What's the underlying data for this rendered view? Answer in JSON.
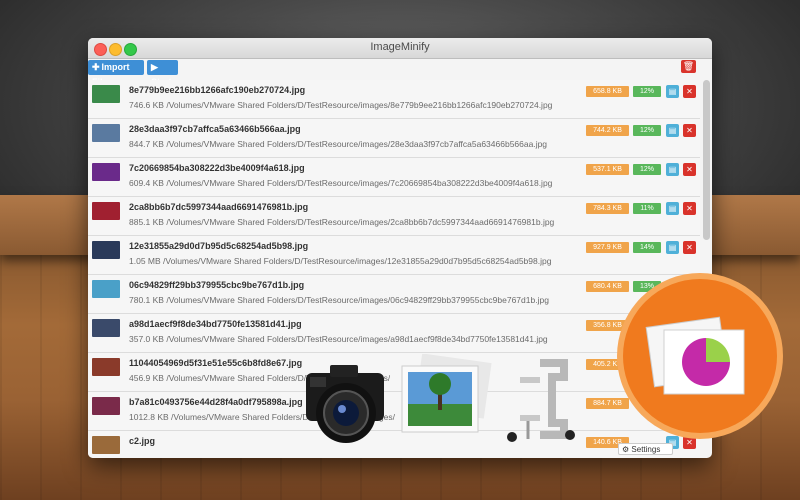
{
  "window": {
    "title": "ImageMinify"
  },
  "toolbar": {
    "import_label": "Import Files",
    "start_label": "Start"
  },
  "files": [
    {
      "name": "8e779b9ee216bb1266afc190eb270724.jpg",
      "detail": "746.6 KB /Volumes/VMware Shared Folders/D/TestResource/images/8e779b9ee216bb1266afc190eb270724.jpg",
      "size": "658.8 KB",
      "pct": "12%",
      "thumb": "#3a8a4a"
    },
    {
      "name": "28e3daa3f97cb7affca5a63466b566aa.jpg",
      "detail": "844.7 KB /Volumes/VMware Shared Folders/D/TestResource/images/28e3daa3f97cb7affca5a63466b566aa.jpg",
      "size": "744.2 KB",
      "pct": "12%",
      "thumb": "#5a7aa0"
    },
    {
      "name": "7c20669854ba308222d3be4009f4a618.jpg",
      "detail": "609.4 KB /Volumes/VMware Shared Folders/D/TestResource/images/7c20669854ba308222d3be4009f4a618.jpg",
      "size": "537.1 KB",
      "pct": "12%",
      "thumb": "#6a2a8a"
    },
    {
      "name": "2ca8bb6b7dc5997344aad6691476981b.jpg",
      "detail": "885.1 KB /Volumes/VMware Shared Folders/D/TestResource/images/2ca8bb6b7dc5997344aad6691476981b.jpg",
      "size": "784.3 KB",
      "pct": "11%",
      "thumb": "#a02030"
    },
    {
      "name": "12e31855a29d0d7b95d5c68254ad5b98.jpg",
      "detail": "1.05 MB /Volumes/VMware Shared Folders/D/TestResource/images/12e31855a29d0d7b95d5c68254ad5b98.jpg",
      "size": "927.9 KB",
      "pct": "14%",
      "thumb": "#2a3a5a"
    },
    {
      "name": "06c94829ff29bb379955cbc9be767d1b.jpg",
      "detail": "780.1 KB /Volumes/VMware Shared Folders/D/TestResource/images/06c94829ff29bb379955cbc9be767d1b.jpg",
      "size": "680.4 KB",
      "pct": "13%",
      "thumb": "#4aa0c8"
    },
    {
      "name": "a98d1aecf9f8de34bd7750fe13581d41.jpg",
      "detail": "357.0 KB /Volumes/VMware Shared Folders/D/TestResource/images/a98d1aecf9f8de34bd7750fe13581d41.jpg",
      "size": "356.8 KB",
      "pct": "",
      "thumb": "#3a4a6a"
    },
    {
      "name": "11044054969d5f31e51e55c6b8fd8e67.jpg",
      "detail": "456.9 KB /Volumes/VMware Shared Folders/D/TestResource/images/",
      "size": "405.2 KB",
      "pct": "",
      "thumb": "#8a3a2a"
    },
    {
      "name": "b7a81c0493756e44d28f4a0df795898a.jpg",
      "detail": "1012.8 KB /Volumes/VMware Shared Folders/D/TestResource/images/",
      "size": "884.7 KB",
      "pct": "",
      "thumb": "#7a2a4a"
    },
    {
      "name": "c2.jpg",
      "detail": "",
      "size": "140.6 KB",
      "pct": "",
      "thumb": "#9a6a3a"
    }
  ],
  "footer": {
    "settings_label": "Settings"
  },
  "colors": {
    "accent": "#3e8fd6",
    "size_badge": "#f0a44a",
    "percent_badge": "#59b75b",
    "delete": "#d9332b",
    "badge_orange": "#f07a1e"
  },
  "icons": {
    "import": "plus-icon",
    "start": "play-icon",
    "trash": "trash-icon",
    "folder": "folder-icon",
    "delete": "close-icon",
    "settings": "gear-icon"
  }
}
